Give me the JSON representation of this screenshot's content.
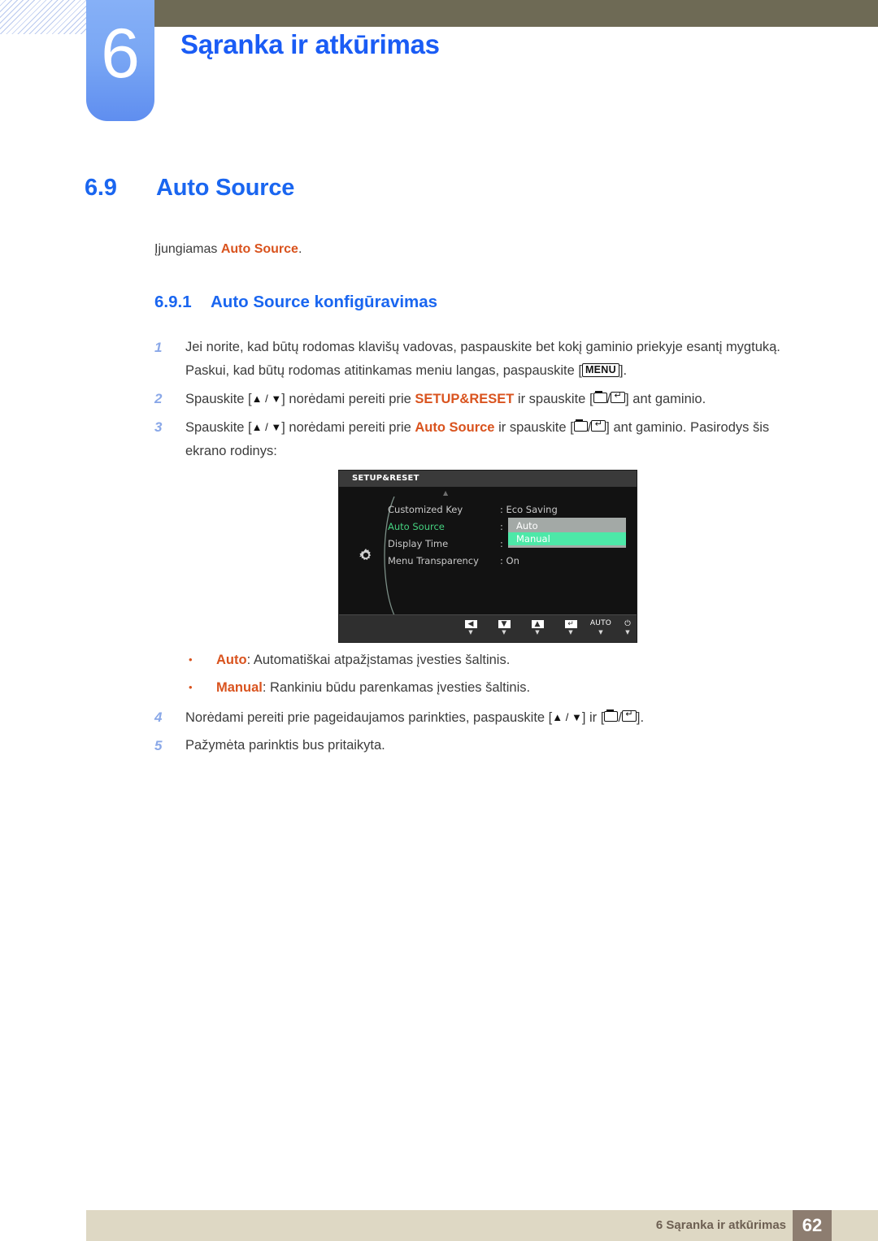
{
  "header": {
    "chapter_number": "6",
    "chapter_title": "Sąranka ir atkūrimas"
  },
  "section": {
    "number": "6.9",
    "title": "Auto Source",
    "intro_prefix": "Įjungiamas ",
    "intro_keyword": "Auto Source",
    "intro_suffix": "."
  },
  "subsection": {
    "number": "6.9.1",
    "title": "Auto Source konfigūravimas"
  },
  "steps": [
    {
      "n": "1",
      "line1": "Jei norite, kad būtų rodomas klavišų vadovas, paspauskite bet kokį gaminio priekyje esantį mygtuką.",
      "line2_prefix": "Paskui, kad būtų rodomas atitinkamas meniu langas, paspauskite [",
      "line2_key": "MENU",
      "line2_suffix": "]."
    },
    {
      "n": "2",
      "prefix": "Spauskite [",
      "arrows": "▲ / ▼",
      "mid": "] norėdami pereiti prie ",
      "keyword": "SETUP&RESET",
      "mid2": " ir spauskite [",
      "sep": "/",
      "suffix": "] ant gaminio."
    },
    {
      "n": "3",
      "prefix": "Spauskite [",
      "arrows": "▲ / ▼",
      "mid": "] norėdami pereiti prie ",
      "keyword": "Auto Source",
      "mid2": " ir spauskite [",
      "sep": "/",
      "suffix": "] ant gaminio. Pasirodys šis",
      "line2": "ekrano rodinys:"
    },
    {
      "n": "4",
      "prefix": "Norėdami pereiti prie pageidaujamos parinkties, paspauskite [",
      "arrows": "▲ / ▼",
      "mid": "] ir [",
      "sep": "/",
      "suffix": "]."
    },
    {
      "n": "5",
      "text": "Pažymėta parinktis bus pritaikyta."
    }
  ],
  "osd": {
    "title": "SETUP&RESET",
    "up_arrow": "▲",
    "menu_items": [
      {
        "label": "Customized Key",
        "value": "Eco Saving",
        "selected": false
      },
      {
        "label": "Auto Source",
        "value": "",
        "selected": true
      },
      {
        "label": "Display Time",
        "value": "",
        "selected": false
      },
      {
        "label": "Menu Transparency",
        "value": "On",
        "selected": false
      }
    ],
    "value_separator": ":",
    "dropdown": {
      "options": [
        {
          "label": "Auto",
          "highlighted": false
        },
        {
          "label": "Manual",
          "highlighted": true
        }
      ]
    },
    "toolbar": [
      {
        "icon": "left-arrow",
        "glyph": "◀",
        "label": "",
        "tick": "▼"
      },
      {
        "icon": "down-arrow",
        "glyph": "▼",
        "label": "",
        "tick": "▼"
      },
      {
        "icon": "up-arrow",
        "glyph": "▲",
        "label": "",
        "tick": "▼"
      },
      {
        "icon": "enter",
        "glyph": "↵",
        "label": "",
        "tick": "▼"
      },
      {
        "icon": "auto",
        "glyph": "",
        "label": "AUTO",
        "tick": "▼"
      },
      {
        "icon": "power",
        "glyph": "⏻",
        "label": "",
        "tick": "▼"
      }
    ],
    "colors": {
      "background": "#121212",
      "title_bar": "#3a3a3a",
      "selected_label": "#44d17f",
      "highlight": "#4de8a8",
      "dropdown_bg": "#a3a9a6"
    }
  },
  "bullets": [
    {
      "marker": "•",
      "keyword": "Auto",
      "text": ": Automatiškai atpažįstamas įvesties šaltinis."
    },
    {
      "marker": "•",
      "keyword": "Manual",
      "text": ": Rankiniu būdu parenkamas įvesties šaltinis."
    }
  ],
  "footer": {
    "text": "6 Sąranka ir atkūrimas",
    "page_number": "62"
  },
  "colors": {
    "heading_blue": "#1a66f0",
    "keyword_orange": "#d9531e",
    "olive": "#6e6a55",
    "footer_bar": "#ded8c4",
    "footer_page_bg": "#8d7d70",
    "chapter_blue": "#7aa7f4"
  }
}
